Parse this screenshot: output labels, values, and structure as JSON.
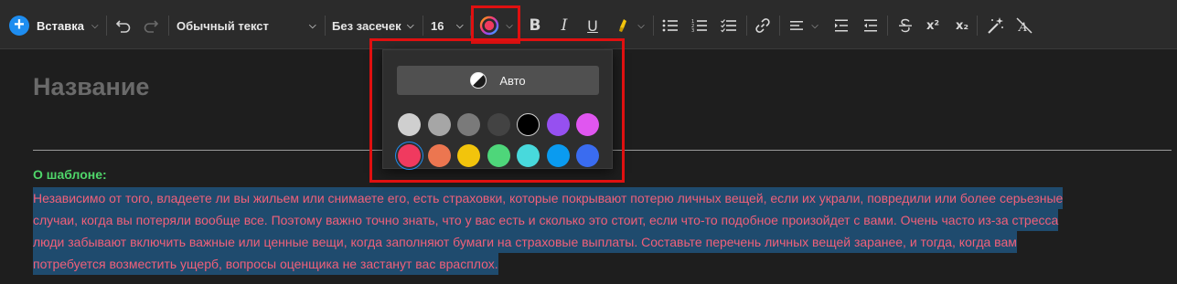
{
  "toolbar": {
    "insert_label": "Вставка",
    "style_value": "Обычный текст",
    "font_value": "Без засечек",
    "size_value": "16",
    "bold_label": "B",
    "italic_label": "I",
    "underline_label": "U",
    "superscript_label": "x²",
    "subscript_label": "x₂",
    "current_text_color": "#f03a5f"
  },
  "document": {
    "title_placeholder": "Название",
    "template_label": "О шаблоне:",
    "paragraph_lines": [
      "Независимо от того, владеете ли вы жильем или снимаете его, есть страховки, которые покрывают потерю личных вещей, если их украли, повредили или более серьезные",
      "случаи, когда вы потеряли вообще все. Поэтому важно точно знать, что у вас есть и сколько это стоит, если что-то подобное произойдет с вами. Очень часто из-за стресса",
      "люди забывают включить важные или ценные вещи, когда заполняют бумаги на страховые выплаты. Составьте перечень личных вещей заранее, и тогда, когда вам",
      "потребуется возместить ущерб, вопросы оценщика не застанут вас врасплох."
    ]
  },
  "color_picker": {
    "auto_label": "Авто",
    "row1": [
      "#cfcfcf",
      "#a6a6a6",
      "#7a7a7a",
      "#434343",
      "#000000",
      "#9650f0",
      "#e056f0"
    ],
    "row2": [
      "#f03a5f",
      "#ec7650",
      "#f2c40c",
      "#4ed67a",
      "#48d9dc",
      "#0a9bf0",
      "#3a6cf0"
    ],
    "selected": "#f03a5f"
  }
}
